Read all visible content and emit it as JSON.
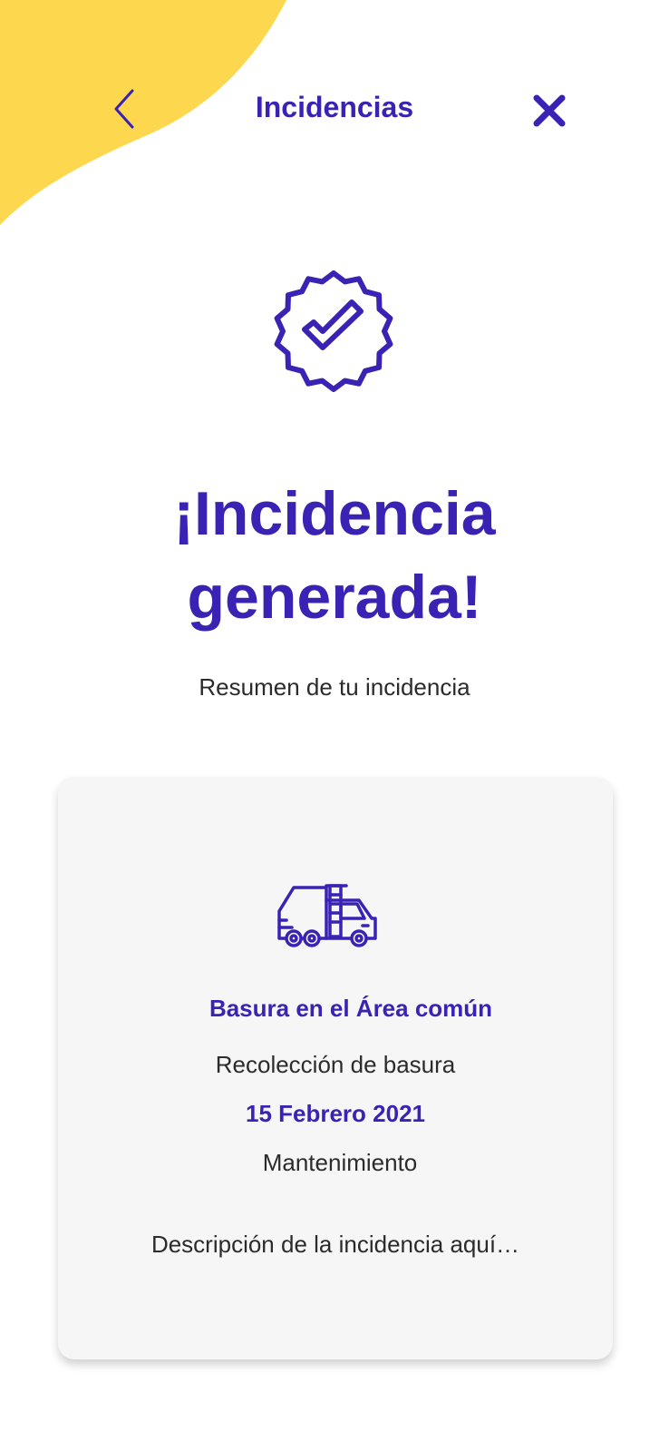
{
  "colors": {
    "accent": "#3a23b4",
    "blob": "#fdd74e",
    "card_background": "#f7f6f7",
    "text": "#2b2b2b"
  },
  "header": {
    "title": "Incidencias",
    "back_icon": "chevron-left-icon",
    "close_icon": "close-icon"
  },
  "status_icon": "check-badge-icon",
  "headline": "¡Incidencia generada!",
  "subtitle": "Resumen de tu incidencia",
  "card": {
    "icon": "garbage-truck-icon",
    "title": "Basura en el Área común",
    "category": "Recolección de basura",
    "date": "15 Febrero 2021",
    "type": "Mantenimiento",
    "description": "Descripción de la incidencia aquí…"
  }
}
